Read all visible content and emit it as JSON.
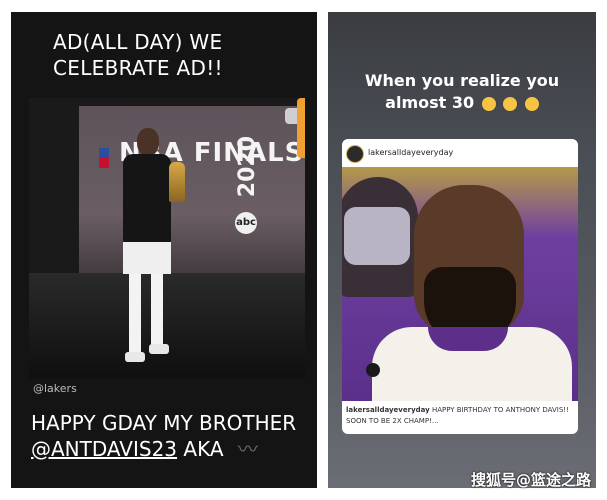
{
  "left_story": {
    "caption_top": "AD(ALL DAY) WE CELEBRATE AD!!",
    "photo_banner_text": "NBA FINALS",
    "photo_banner_year": "2020",
    "photo_network": "abc",
    "credit": "@lakers",
    "caption_bottom_line1": "HAPPY GDAY MY BROTHER",
    "caption_bottom_handle": "@ANTDAVIS23",
    "caption_bottom_suffix": "AKA"
  },
  "right_story": {
    "caption": "When you realize you almost 30",
    "emoji_name": "laughing-emoji",
    "post": {
      "username": "lakersalldayeveryday",
      "caption_user": "lakersalldayeveryday",
      "caption_text": "HAPPY BIRTHDAY TO ANTHONY DAVIS!! SOON TO BE 2X CHAMP!..."
    }
  },
  "watermark": "搜狐号@篮途之路",
  "colors": {
    "left_bg": "#141414",
    "right_bg": "#4a4f55",
    "lakers_purple": "#5e2f8a",
    "lakers_gold": "#f6c343"
  }
}
